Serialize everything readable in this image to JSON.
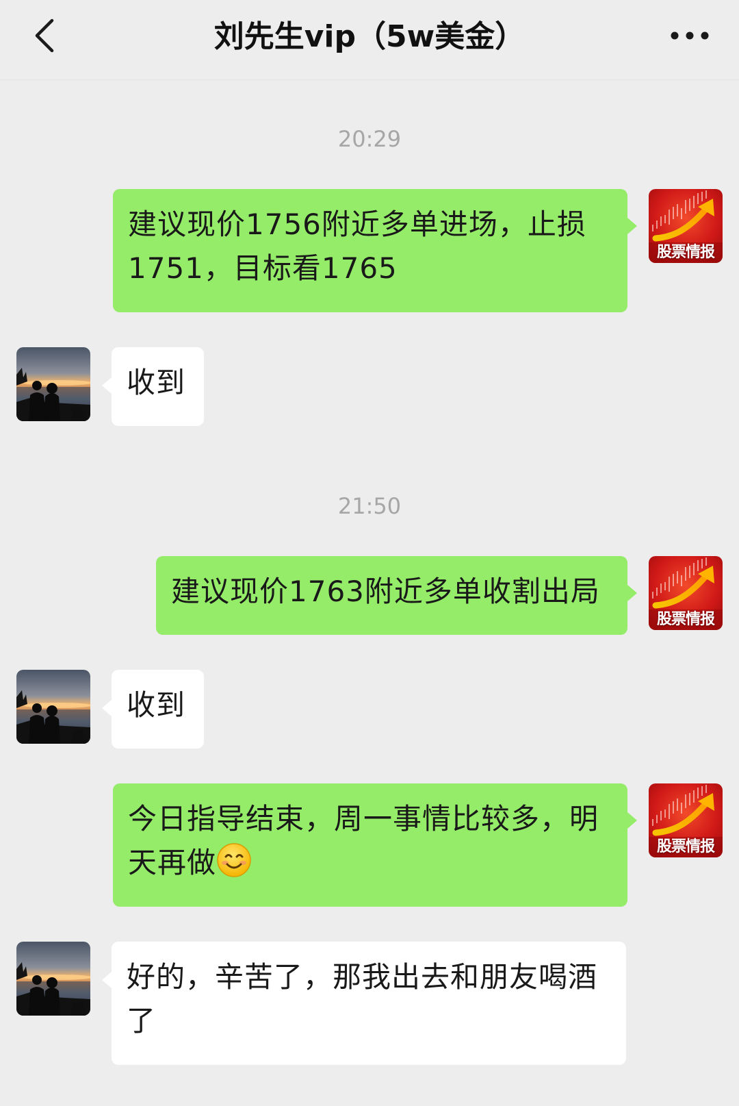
{
  "header": {
    "title": "刘先生vip（5w美金）",
    "back_icon": "chevron-left-icon",
    "more_icon": "more-dots-icon"
  },
  "colors": {
    "background": "#ededed",
    "outgoing_bubble": "#95ec69",
    "incoming_bubble": "#ffffff",
    "timestamp": "#a6a6a6"
  },
  "timestamps": [
    "20:29",
    "21:50"
  ],
  "messages": [
    {
      "side": "outgoing",
      "text": "建议现价1756附近多单进场，止损1751，目标看1765"
    },
    {
      "side": "incoming",
      "text": "收到"
    },
    {
      "side": "outgoing",
      "text": "建议现价1763附近多单收割出局"
    },
    {
      "side": "incoming",
      "text": "收到"
    },
    {
      "side": "outgoing",
      "text": "今日指导结束，周一事情比较多，明天再做",
      "emoji": "smiling-face-icon"
    },
    {
      "side": "incoming",
      "text": "好的，辛苦了，那我出去和朋友喝酒了"
    }
  ],
  "sender_avatar": {
    "label": "股票情报",
    "icon": "stock-chart-arrow-icon",
    "color": "#d42020"
  },
  "contact_avatar": {
    "icon": "sunset-silhouette-photo"
  }
}
